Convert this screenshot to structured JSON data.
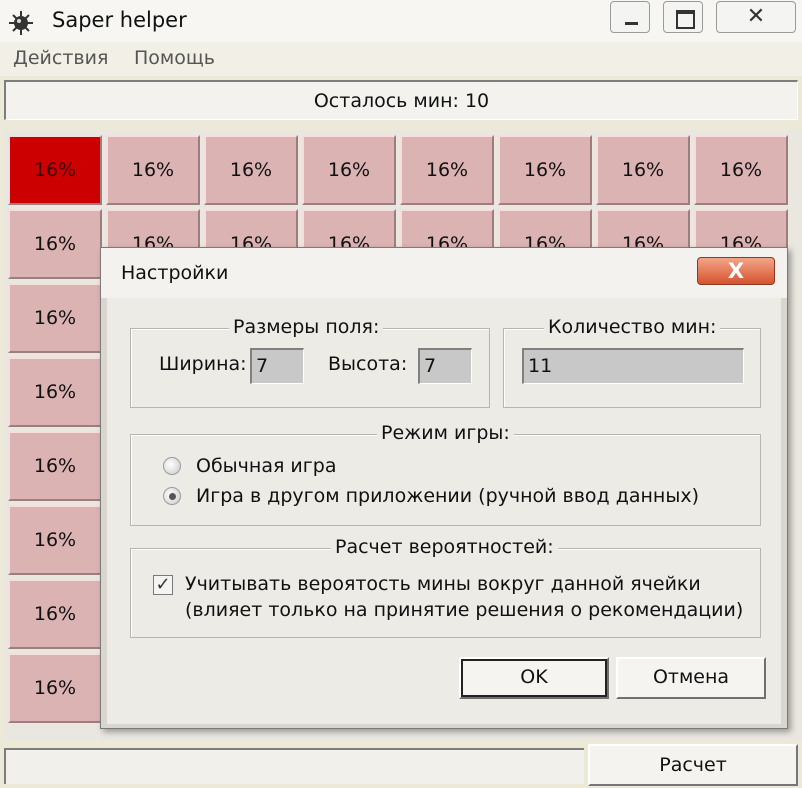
{
  "window": {
    "title": "Saper helper",
    "close_glyph": "✕"
  },
  "menu": [
    "Действия",
    "Помощь"
  ],
  "status": {
    "mines_left": "Осталось мин: 10"
  },
  "grid": {
    "cell_value": "16%",
    "active_cell_color": "#cc0000",
    "cell_color": "#dcb3b3"
  },
  "footer": {
    "calc_button": "Расчет"
  },
  "dialog": {
    "title": "Настройки",
    "close_glyph": "X",
    "field_size": {
      "legend": "Размеры поля:",
      "width_label": "Ширина:",
      "width_value": "7",
      "height_label": "Высота:",
      "height_value": "7"
    },
    "mines": {
      "legend": "Количество мин:",
      "value": "11"
    },
    "mode": {
      "legend": "Режим игры:",
      "options": [
        "Обычная игра",
        "Игра в другом приложении (ручной ввод данных)"
      ],
      "selected_index": 1
    },
    "probability": {
      "legend": "Расчет вероятностей:",
      "checkbox_line1": "Учитывать вероятость мины вокруг данной ячейки",
      "checkbox_line2": "(влияет только на принятие решения о рекомендации)",
      "checked": true
    },
    "buttons": {
      "ok": "OK",
      "cancel": "Отмена"
    }
  }
}
